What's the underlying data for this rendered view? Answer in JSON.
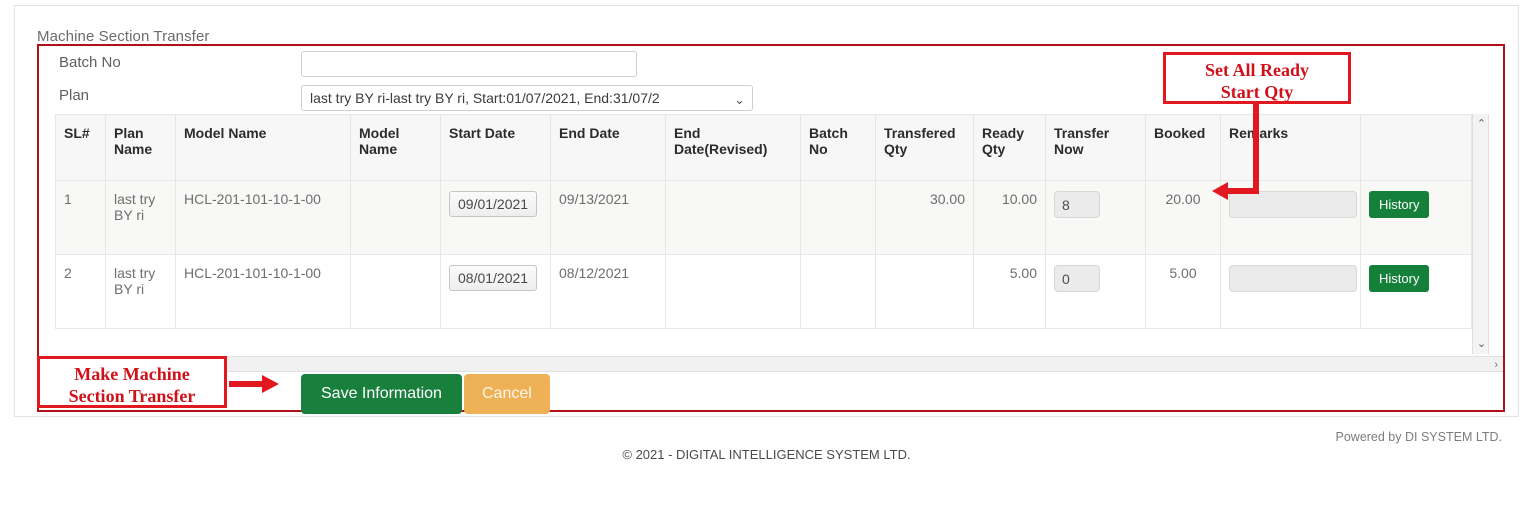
{
  "page": {
    "title": "Machine Section Transfer"
  },
  "form": {
    "batch_label": "Batch No",
    "batch_value": "",
    "batch_placeholder": "",
    "plan_label": "Plan",
    "plan_selected": "last try BY ri-last try BY ri, Start:01/07/2021, End:31/07/2",
    "plan_options": [
      "last try BY ri-last try BY ri, Start:01/07/2021, End:31/07/2"
    ]
  },
  "table": {
    "columns": [
      "SL#",
      "Plan Name",
      "Model Name",
      "Model Name",
      "Start Date",
      "End Date",
      "End Date(Revised)",
      "Batch No",
      "Transfered Qty",
      "Ready Qty",
      "Transfer Now",
      "Booked",
      "Remarks",
      ""
    ],
    "rows": [
      {
        "sl": "1",
        "plan_name": "last try BY ri",
        "model_name": "HCL-201-101-10-1-00",
        "model_name_2": "",
        "start_date": "09/01/2021",
        "end_date": "09/13/2021",
        "end_date_revised": "",
        "batch_no": "",
        "transfered_qty": "30.00",
        "ready_qty": "10.00",
        "transfer_now": "8",
        "booked": "20.00",
        "remarks": "",
        "history_label": "History"
      },
      {
        "sl": "2",
        "plan_name": "last try BY ri",
        "model_name": "HCL-201-101-10-1-00",
        "model_name_2": "",
        "start_date": "08/01/2021",
        "end_date": "08/12/2021",
        "end_date_revised": "",
        "batch_no": "",
        "transfered_qty": "",
        "ready_qty": "5.00",
        "transfer_now": "0",
        "booked": "5.00",
        "remarks": "",
        "history_label": "History"
      }
    ]
  },
  "actions": {
    "save_label": "Save Information",
    "cancel_label": "Cancel"
  },
  "annotations": {
    "set_all_ready_line1": "Set All Ready",
    "set_all_ready_line2": "Start Qty",
    "make_transfer_line1": "Make Machine",
    "make_transfer_line2": "Section Transfer"
  },
  "scrollbars": {
    "up_arrow": "⌃",
    "down_arrow": "⌄",
    "left_arrow": "‹",
    "right_arrow": "›"
  },
  "select_chevron": "⌄",
  "footer": {
    "powered_by": "Powered by DI SYSTEM LTD.",
    "copyright": "© 2021 - DIGITAL INTELLIGENCE SYSTEM LTD."
  },
  "colors": {
    "panel_border_red": "#b01116",
    "annotation_red": "#e1181f",
    "save_green": "#18803c",
    "cancel_orange": "#eeb155",
    "history_green": "#15803a"
  }
}
